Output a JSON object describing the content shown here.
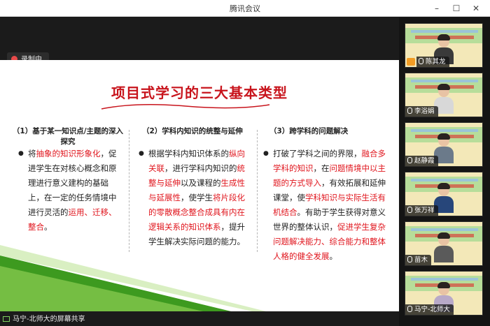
{
  "window": {
    "title": "腾讯会议",
    "controls": {
      "minimize": "–",
      "maximize": "☐",
      "close": "✕"
    }
  },
  "recording": {
    "label": "录制中"
  },
  "slide": {
    "title": "项目式学习的三大基本类型",
    "columns": [
      {
        "heading_line1": "（1）基于某一知识点/主题的深入",
        "heading_line2": "探究",
        "text_parts": [
          {
            "text": "将",
            "red": false
          },
          {
            "text": "抽象的知识形象化",
            "red": true
          },
          {
            "text": "，促进学生在对核心概念和原理进行意义建构的基础上，在一定的任务情境中进行灵活的",
            "red": false
          },
          {
            "text": "运用、迁移、整合",
            "red": true
          },
          {
            "text": "。",
            "red": false
          }
        ]
      },
      {
        "heading_line1": "（2）学科内知识的统整与延伸",
        "text_parts": [
          {
            "text": "根据学科内知识体系的",
            "red": false
          },
          {
            "text": "纵向关联",
            "red": true
          },
          {
            "text": "，进行学科内知识的",
            "red": false
          },
          {
            "text": "统整与延伸",
            "red": true
          },
          {
            "text": "以及课程的",
            "red": false
          },
          {
            "text": "生成性与延展性",
            "red": true
          },
          {
            "text": "，使学生",
            "red": false
          },
          {
            "text": "将片段化的零散概念整合成具有内在逻辑关系的知识体系",
            "red": true
          },
          {
            "text": "，提升学生解决实际问题的能力。",
            "red": false
          }
        ]
      },
      {
        "heading_line1": "（3）跨学科的问题解决",
        "text_parts": [
          {
            "text": "打破了学科之间的界限，",
            "red": false
          },
          {
            "text": "融合多学科的知识",
            "red": true
          },
          {
            "text": "，在",
            "red": false
          },
          {
            "text": "问题情境中以主题的方式导入",
            "red": true
          },
          {
            "text": "，有效拓展和延伸课堂，使",
            "red": false
          },
          {
            "text": "学科知识与实际生活有机结合",
            "red": true
          },
          {
            "text": "。有助于学生获得对意义世界的整体认识，",
            "red": false
          },
          {
            "text": "促进学生复杂问题解决能力、综合能力和整体人格的健全发展",
            "red": true
          },
          {
            "text": "。",
            "red": false
          }
        ]
      }
    ]
  },
  "screen_share": {
    "label": "马宁-北师大的屏幕共享"
  },
  "participants": [
    {
      "name": "陈其龙",
      "shirt": "#3a3a3a"
    },
    {
      "name": "李浴娟",
      "shirt": "#d8d8d8"
    },
    {
      "name": "赵静霞",
      "shirt": "#6b7a8a"
    },
    {
      "name": "张万祥",
      "shirt": "#27467a"
    },
    {
      "name": "苗木",
      "shirt": "#5a5a5a"
    },
    {
      "name": "马宁-北师大",
      "shirt": "#b8a9c8"
    }
  ],
  "colors": {
    "title_red": "#c8141c",
    "highlight_red": "#e0151d",
    "recording_dot": "#e84a4a",
    "tile_background": "#f3e8b8"
  }
}
